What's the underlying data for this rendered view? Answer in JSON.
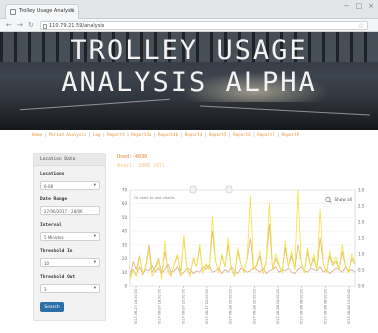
{
  "browser": {
    "tab_title": "Trolley Usage Analysis",
    "tab_close": "×",
    "url": "110.79.21.59/analysis",
    "win_controls": [
      "−",
      "□",
      "×"
    ]
  },
  "hero": {
    "title_line1": "TROLLEY USAGE",
    "title_line2": "ANALYSIS ALPHA"
  },
  "nav": {
    "links": [
      "Home",
      "Period Analysis",
      "Log",
      "Report4",
      "Report4a",
      "Report4b",
      "Report4",
      "Report5",
      "Report6",
      "Report7",
      "ReportP"
    ]
  },
  "panel": {
    "header": "Location Data",
    "location_label": "Locations",
    "location_value": "6-08",
    "date_label": "Date Range",
    "date_value": "27/06/2017 - 28/06",
    "interval_label": "Interval",
    "interval_value": "5 Minutes",
    "threshold_in_label": "Threshold In",
    "threshold_in_value": "10",
    "threshold_out_label": "Threshold Out",
    "threshold_out_value": "3",
    "search_label": "Search"
  },
  "stats": {
    "used": "Used: 4030",
    "available": "Avail: 1000 (67)"
  },
  "chart_data": {
    "type": "line",
    "hint": "Or start to see charts",
    "show_all": "Show all",
    "y_left_ticks": [
      "0",
      "10",
      "20",
      "30",
      "40",
      "50",
      "60",
      "70"
    ],
    "y_right_ticks": [
      "0.0",
      "0.5",
      "1.0",
      "1.5",
      "2.0",
      "2.5",
      "3.0"
    ],
    "ylim_left": [
      0,
      70
    ],
    "ylim_right": [
      0,
      3
    ],
    "x_ticks": [
      "2017-06-27 16:00:00",
      "2017-06-27 18:00:00",
      "2017-06-27 20:00:00",
      "2017-06-27 22:00:00",
      "2017-06-28 00:00:00",
      "2017-06-28 02:00:00",
      "2017-06-28 04:00:00",
      "2017-06-28 06:00:00",
      "2017-06-28 08:00:00",
      "2017-06-28 10:00:00"
    ],
    "colors": {
      "series_a": "#e8b56a",
      "series_b": "#f0e34a",
      "series_c": "#d9a98a"
    },
    "series": [
      {
        "axis": "left",
        "color_key": "series_c",
        "values": [
          10,
          12,
          8,
          14,
          9,
          12,
          11,
          15,
          10,
          13,
          9,
          12,
          16,
          10,
          11,
          14,
          8,
          10,
          13,
          12,
          9,
          11,
          10,
          14,
          12,
          15,
          10,
          11,
          13,
          9,
          12,
          10,
          14,
          11,
          9,
          13,
          12,
          10,
          11,
          14,
          12,
          10,
          13,
          9,
          11,
          12,
          14,
          10,
          12,
          11,
          13,
          10,
          9,
          12,
          14,
          11,
          10,
          13,
          12,
          11,
          14,
          10,
          12,
          9,
          11,
          13,
          12,
          10,
          14,
          11,
          12,
          10
        ]
      },
      {
        "axis": "left",
        "color_key": "series_a",
        "values": [
          5,
          18,
          12,
          22,
          8,
          15,
          30,
          10,
          14,
          20,
          9,
          25,
          12,
          8,
          16,
          22,
          10,
          35,
          12,
          9,
          20,
          14,
          28,
          10,
          15,
          12,
          40,
          18,
          10,
          22,
          14,
          30,
          12,
          8,
          25,
          16,
          10,
          20,
          35,
          12,
          15,
          22,
          9,
          18,
          45,
          12,
          20,
          15,
          10,
          28,
          14,
          22,
          12,
          30,
          18,
          10,
          25,
          14,
          20,
          12,
          35,
          16,
          10,
          22,
          15,
          18,
          12,
          25,
          14,
          10,
          20,
          16
        ]
      },
      {
        "axis": "right",
        "color_key": "series_b",
        "values": [
          0.2,
          0.5,
          0.3,
          0.9,
          0.4,
          0.6,
          1.1,
          0.3,
          0.5,
          0.8,
          0.2,
          1.4,
          0.4,
          0.3,
          0.7,
          1.0,
          0.3,
          1.6,
          0.5,
          0.3,
          0.9,
          0.6,
          1.3,
          0.4,
          0.7,
          0.5,
          2.2,
          0.8,
          0.4,
          1.0,
          0.6,
          1.5,
          0.5,
          0.3,
          1.2,
          0.7,
          0.4,
          0.9,
          2.8,
          0.5,
          0.7,
          1.1,
          0.4,
          0.8,
          2.6,
          0.5,
          1.0,
          0.7,
          0.4,
          1.4,
          0.6,
          1.1,
          0.5,
          3.0,
          0.8,
          0.4,
          1.2,
          0.6,
          1.0,
          0.5,
          2.4,
          0.7,
          0.4,
          1.1,
          0.7,
          0.9,
          0.5,
          1.3,
          0.6,
          0.4,
          1.0,
          0.7
        ]
      }
    ]
  }
}
